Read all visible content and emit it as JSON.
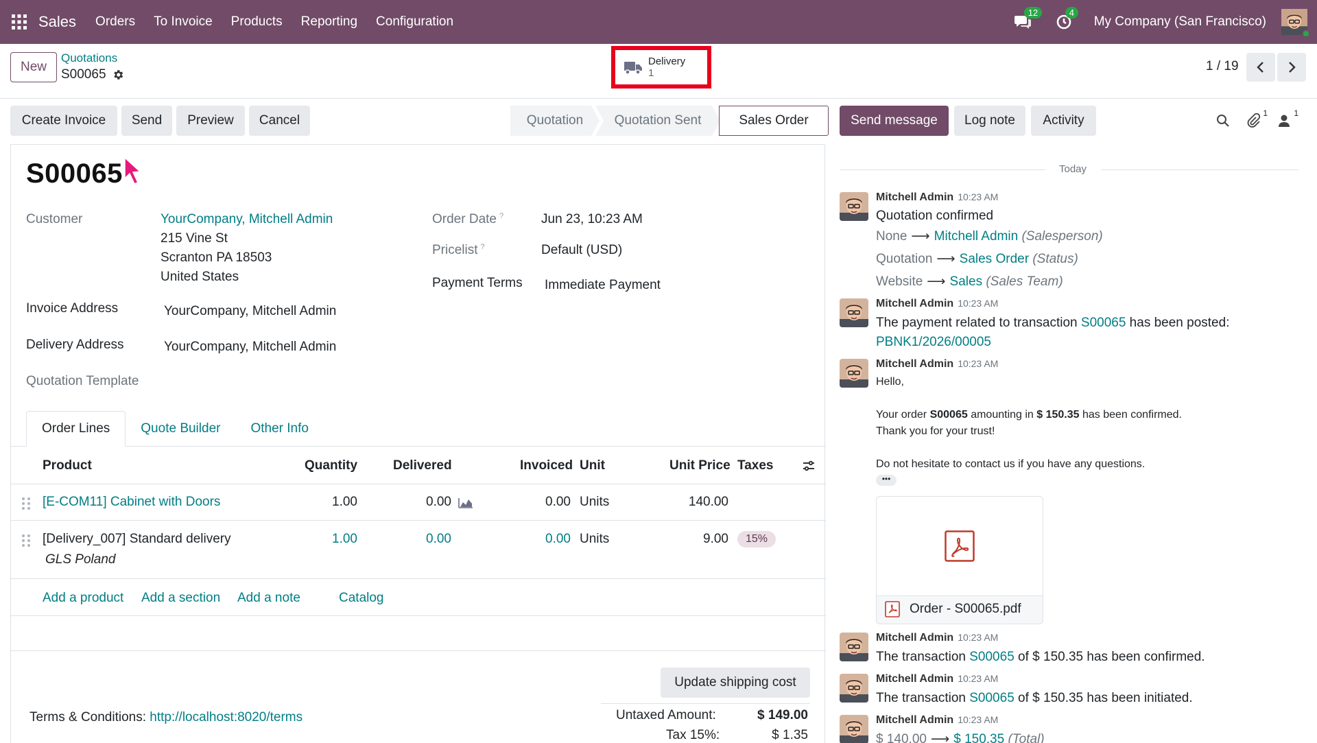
{
  "navbar": {
    "brand": "Sales",
    "menus": [
      "Orders",
      "To Invoice",
      "Products",
      "Reporting",
      "Configuration"
    ],
    "messages_count": "12",
    "activities_count": "4",
    "company": "My Company (San Francisco)"
  },
  "control_panel": {
    "new_label": "New",
    "breadcrumb_parent": "Quotations",
    "breadcrumb_current": "S00065",
    "smart_button": {
      "label": "Delivery",
      "count": "1"
    },
    "pager": "1 / 19"
  },
  "actions": {
    "create_invoice": "Create Invoice",
    "send": "Send",
    "preview": "Preview",
    "cancel": "Cancel"
  },
  "statusbar": {
    "steps": [
      "Quotation",
      "Quotation Sent",
      "Sales Order"
    ],
    "current": "Sales Order"
  },
  "chatter_actions": {
    "send_message": "Send message",
    "log_note": "Log note",
    "activity": "Activity",
    "attachments_count": "1",
    "followers_count": "1"
  },
  "form": {
    "name": "S00065",
    "customer_label": "Customer",
    "customer_name": "YourCompany, Mitchell Admin",
    "customer_address": [
      "215 Vine St",
      "Scranton PA 18503",
      "United States"
    ],
    "invoice_address_label": "Invoice Address",
    "invoice_address": "YourCompany, Mitchell Admin",
    "delivery_address_label": "Delivery Address",
    "delivery_address": "YourCompany, Mitchell Admin",
    "quotation_template_label": "Quotation Template",
    "order_date_label": "Order Date",
    "order_date": "Jun 23, 10:23 AM",
    "pricelist_label": "Pricelist",
    "pricelist": "Default (USD)",
    "payment_terms_label": "Payment Terms",
    "payment_terms": "Immediate Payment",
    "help_mark": "?"
  },
  "tabs": [
    "Order Lines",
    "Quote Builder",
    "Other Info"
  ],
  "order_lines": {
    "columns": [
      "Product",
      "Quantity",
      "Delivered",
      "Invoiced",
      "Unit",
      "Unit Price",
      "Taxes"
    ],
    "rows": [
      {
        "product": "[E-COM11] Cabinet with Doors",
        "description": "",
        "quantity": "1.00",
        "delivered": "0.00",
        "invoiced": "0.00",
        "unit": "Units",
        "unit_price": "140.00",
        "taxes": ""
      },
      {
        "product": "[Delivery_007] Standard delivery",
        "description": "GLS Poland",
        "quantity": "1.00",
        "delivered": "0.00",
        "invoiced": "0.00",
        "unit": "Units",
        "unit_price": "9.00",
        "taxes": "15%"
      }
    ],
    "add_product": "Add a product",
    "add_section": "Add a section",
    "add_note": "Add a note",
    "catalog": "Catalog"
  },
  "footer": {
    "update_shipping": "Update shipping cost",
    "terms_label": "Terms & Conditions:",
    "terms_link": "http://localhost:8020/terms",
    "untaxed_label": "Untaxed Amount:",
    "untaxed_value": "$ 149.00",
    "tax_label": "Tax 15%:",
    "tax_value": "$ 1.35"
  },
  "chatter": {
    "today": "Today",
    "messages": [
      {
        "author": "Mitchell Admin",
        "time": "10:23 AM",
        "title": "Quotation confirmed",
        "changes": [
          {
            "old": "None",
            "new": "Mitchell Admin",
            "field": "(Salesperson)"
          },
          {
            "old": "Quotation",
            "new": "Sales Order",
            "field": "(Status)"
          },
          {
            "old": "Website",
            "new": "Sales",
            "field": "(Sales Team)"
          }
        ]
      },
      {
        "author": "Mitchell Admin",
        "time": "10:23 AM",
        "text_before": "The payment related to transaction ",
        "link": "S00065",
        "text_after": " has been posted:",
        "link2": "PBNK1/2026/00005"
      },
      {
        "author": "Mitchell Admin",
        "time": "10:23 AM",
        "hello": "Hello,",
        "order_pre": "Your order ",
        "order_ref": "S00065",
        "order_mid": " amounting in ",
        "order_amount": "$ 150.35",
        "order_post": " has been confirmed.",
        "thanks": "Thank you for your trust!",
        "contact": "Do not hesitate to contact us if you have any questions.",
        "more": "•••",
        "attachment": "Order - S00065.pdf"
      },
      {
        "author": "Mitchell Admin",
        "time": "10:23 AM",
        "pre": "The transaction ",
        "link": "S00065",
        "post": " of $ 150.35 has been confirmed."
      },
      {
        "author": "Mitchell Admin",
        "time": "10:23 AM",
        "pre": "The transaction ",
        "link": "S00065",
        "post": " of $ 150.35 has been initiated."
      },
      {
        "author": "Mitchell Admin",
        "time": "10:23 AM",
        "old": "$ 140.00",
        "new": "$ 150.35",
        "field": "(Total)"
      }
    ]
  },
  "colors": {
    "brand": "#714b67",
    "link": "#017e84",
    "highlight_box": "#e8001c",
    "counter": "#28a745"
  }
}
